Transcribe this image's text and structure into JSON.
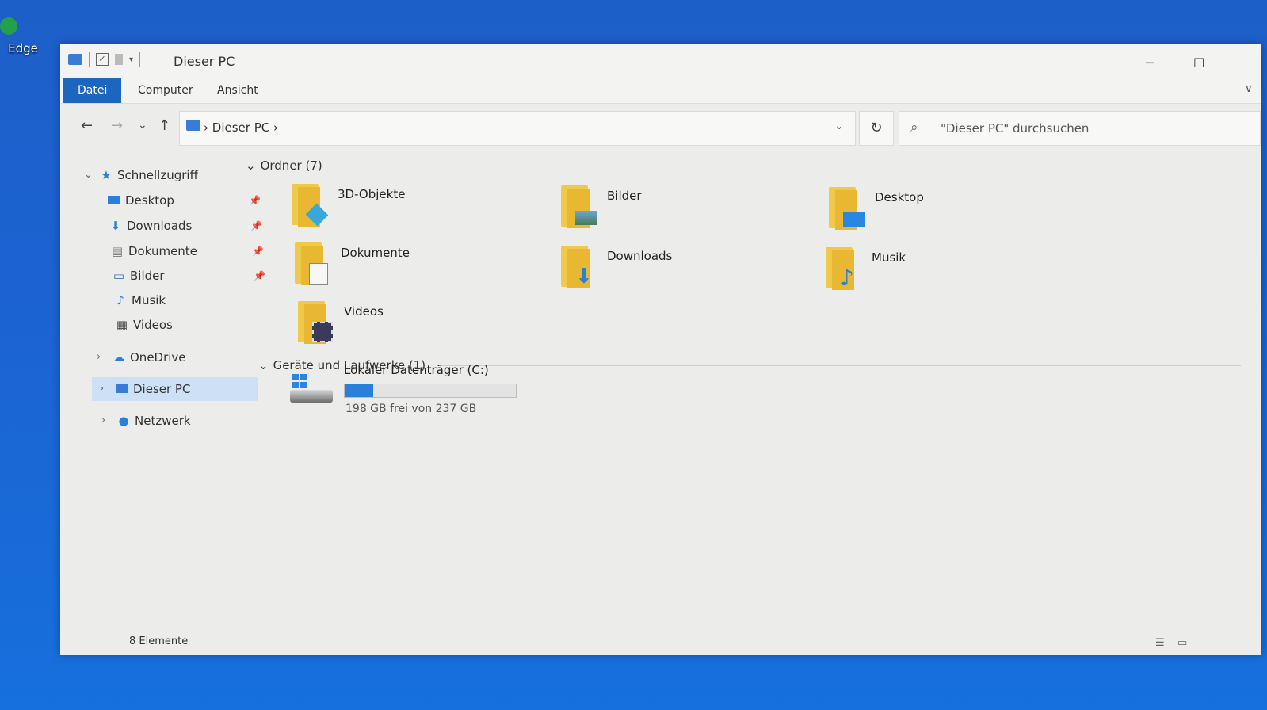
{
  "desktop": {
    "edge_label": "Edge"
  },
  "window": {
    "title": "Dieser PC",
    "minimize": "─",
    "maximize": "☐"
  },
  "ribbon": {
    "tabs": [
      {
        "label": "Datei",
        "active": true
      },
      {
        "label": "Computer",
        "active": false
      },
      {
        "label": "Ansicht",
        "active": false
      }
    ],
    "collapse": "∨"
  },
  "nav": {
    "back": "←",
    "forward": "→",
    "recent": "⌄",
    "up": "↑",
    "breadcrumb": "›  Dieser PC  ›",
    "address_dropdown": "⌄",
    "refresh": "↻",
    "search_placeholder": "\"Dieser PC\" durchsuchen"
  },
  "sidebar": {
    "quick_access": "Schnellzugriff",
    "items": [
      {
        "label": "Desktop",
        "pinned": true
      },
      {
        "label": "Downloads",
        "pinned": true
      },
      {
        "label": "Dokumente",
        "pinned": true
      },
      {
        "label": "Bilder",
        "pinned": true
      },
      {
        "label": "Musik",
        "pinned": false
      },
      {
        "label": "Videos",
        "pinned": false
      }
    ],
    "onedrive": "OneDrive",
    "this_pc": "Dieser PC",
    "network": "Netzwerk"
  },
  "content": {
    "folders_header": "Ordner (7)",
    "folders": [
      {
        "label": "3D-Objekte",
        "icon": "cube-icon"
      },
      {
        "label": "Bilder",
        "icon": "picture-icon"
      },
      {
        "label": "Desktop",
        "icon": "desktop-icon"
      },
      {
        "label": "Dokumente",
        "icon": "document-icon"
      },
      {
        "label": "Downloads",
        "icon": "download-arrow-icon"
      },
      {
        "label": "Musik",
        "icon": "music-note-icon"
      },
      {
        "label": "Videos",
        "icon": "film-icon"
      }
    ],
    "devices_header": "Geräte und Laufwerke (1)",
    "drive": {
      "name": "Lokaler Datenträger (C:)",
      "free_text": "198 GB frei von 237 GB",
      "used_fraction": 0.165
    }
  },
  "status": {
    "count": "8 Elemente"
  },
  "colors": {
    "accent": "#1c66c0",
    "folder": "#f0c94a",
    "drive_bar": "#2a7fd8"
  }
}
